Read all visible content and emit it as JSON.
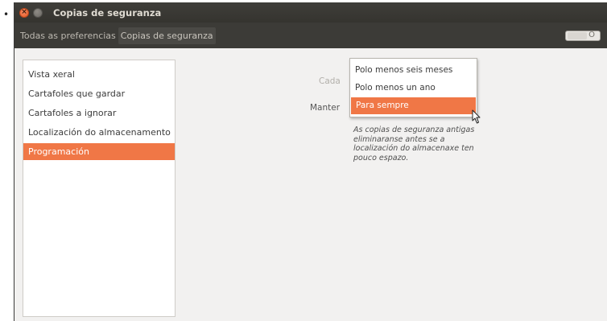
{
  "page": {
    "bullet": "•"
  },
  "window": {
    "title": "Copias de seguranza",
    "close_glyph": "×"
  },
  "toolbar": {
    "breadcrumb": [
      "Todas as preferencias",
      "Copias de seguranza"
    ],
    "toggle_state": "O"
  },
  "sidebar": {
    "items": [
      {
        "label": "Vista xeral"
      },
      {
        "label": "Cartafoles que gardar"
      },
      {
        "label": "Cartafoles a ignorar"
      },
      {
        "label": "Localización do almacenamento"
      },
      {
        "label": "Programación"
      }
    ],
    "selected_index": 4
  },
  "schedule": {
    "every_label": "Cada",
    "keep_label": "Manter",
    "keep_options": [
      "Polo menos seis meses",
      "Polo menos un ano",
      "Para sempre"
    ],
    "highlighted_option_index": 2,
    "note": "As copias de seguranza antigas eliminaranse antes se a localización do almacenaxe ten pouco espazo."
  },
  "colors": {
    "accent": "#f07746",
    "titlebar": "#3c3b37",
    "window_bg": "#f2f1f0"
  },
  "icons": {
    "window_close": "close-icon",
    "window_minimize": "minimize-icon",
    "cursor": "mouse-pointer-icon"
  }
}
